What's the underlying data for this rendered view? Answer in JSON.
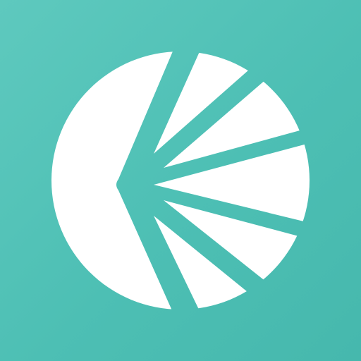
{
  "app_icon": {
    "icon": "fan-circle-logo-icon",
    "colors": {
      "background": "#4fc0b6",
      "foreground": "#ffffff"
    }
  }
}
